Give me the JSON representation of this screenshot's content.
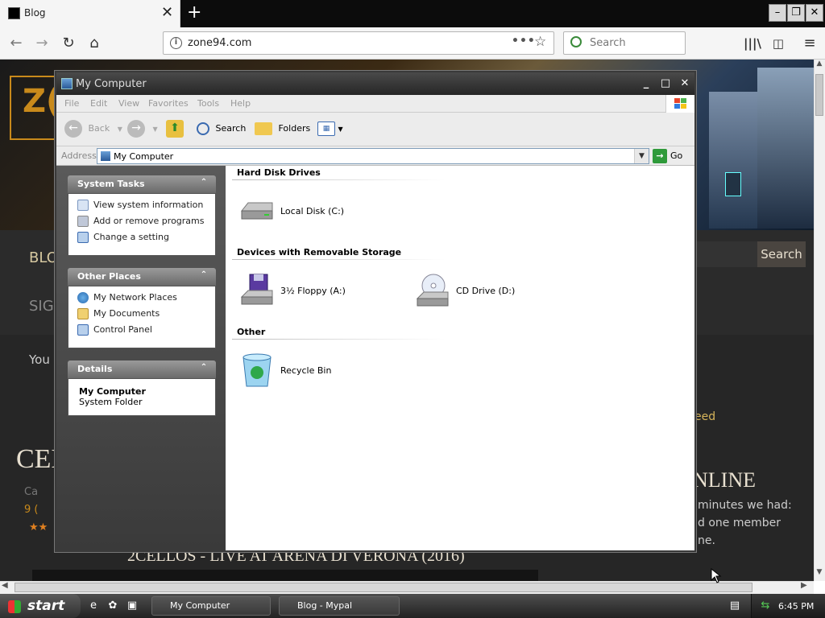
{
  "browser": {
    "tab_title": "Blog",
    "tab_close": "✕",
    "new_tab": "+",
    "url": "zone94.com",
    "search_placeholder": "Search",
    "window_buttons": {
      "minimize": "–",
      "restore": "❐",
      "close": "✕"
    }
  },
  "webpage": {
    "blog": "BLO",
    "sign": "SIG",
    "you": "You",
    "search_button": "Search",
    "feed": "eed",
    "cel": "CEL",
    "ca": "Ca",
    "nine": "9 (",
    "stars": "★★",
    "online": "NLINE",
    "online_line1": "minutes we had:",
    "online_line2": "d one member",
    "online_line3": "ne.",
    "video_title": "2CELLOS - LIVE AT ARENA DI VERONA (2016)",
    "logo_fragment": "Z("
  },
  "explorer": {
    "title": "My Computer",
    "menus": [
      "File",
      "Edit",
      "View",
      "Favorites",
      "Tools",
      "Help"
    ],
    "toolbar": {
      "back": "Back",
      "search": "Search",
      "folders": "Folders"
    },
    "address_label": "Address",
    "address_value": "My Computer",
    "go_label": "Go",
    "task_panes": [
      {
        "title": "System Tasks",
        "items": [
          "View system information",
          "Add or remove programs",
          "Change a setting"
        ]
      },
      {
        "title": "Other Places",
        "items": [
          "My Network Places",
          "My Documents",
          "Control Panel"
        ]
      },
      {
        "title": "Details",
        "detail_name": "My Computer",
        "detail_type": "System Folder"
      }
    ],
    "groups": [
      {
        "title": "Hard Disk Drives",
        "items": [
          "Local Disk (C:)"
        ]
      },
      {
        "title": "Devices with Removable Storage",
        "items": [
          "3½ Floppy (A:)",
          "CD Drive (D:)"
        ]
      },
      {
        "title": "Other",
        "items": [
          "Recycle Bin"
        ]
      }
    ]
  },
  "taskbar": {
    "start_label": "start",
    "buttons": [
      "My Computer",
      "Blog - Mypal"
    ],
    "clock": "6:45 PM"
  }
}
